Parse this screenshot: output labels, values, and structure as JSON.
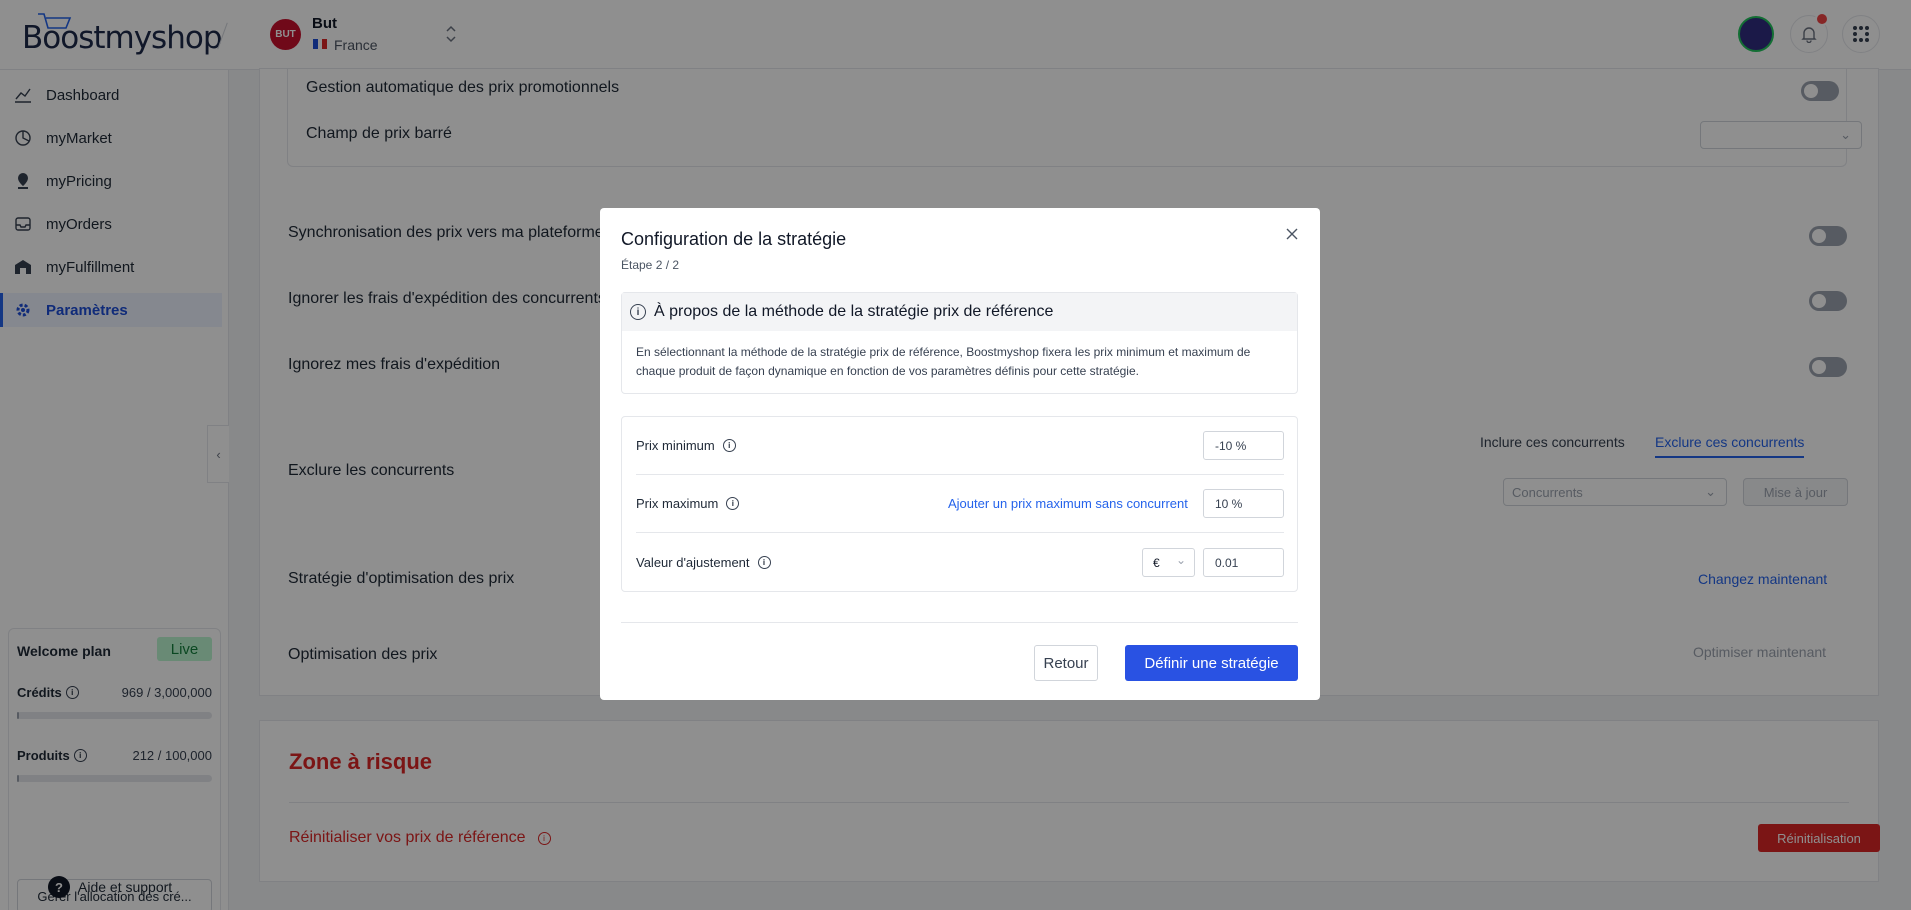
{
  "header": {
    "logo_text": "Boostmyshop",
    "shop_badge": "BUT",
    "shop_name": "But",
    "shop_country": "France"
  },
  "sidebar": {
    "items": [
      {
        "label": "Dashboard",
        "icon": "chart-line-icon"
      },
      {
        "label": "myMarket",
        "icon": "market-icon"
      },
      {
        "label": "myPricing",
        "icon": "pricing-pin-icon"
      },
      {
        "label": "myOrders",
        "icon": "inbox-icon"
      },
      {
        "label": "myFulfillment",
        "icon": "warehouse-icon"
      },
      {
        "label": "Paramètres",
        "icon": "gear-icon",
        "active": true
      }
    ],
    "plan": {
      "name": "Welcome plan",
      "badge": "Live",
      "credits_label": "Crédits",
      "credits_value": "969 / 3,000,000",
      "credits_fraction": 0.0003,
      "products_label": "Produits",
      "products_value": "212 / 100,000",
      "products_fraction": 0.002,
      "allocation_button": "Gérer l'allocation des cré..."
    },
    "help": "Aide et support"
  },
  "main": {
    "promo_auto": "Gestion automatique des prix promotionnels",
    "strike_price": "Champ de prix barré",
    "sync_prices": "Synchronisation des prix vers ma plateforme",
    "ignore_competitor_shipping": "Ignorer les frais d'expédition des concurrents",
    "ignore_my_shipping": "Ignorez mes frais d'expédition",
    "exclude_competitors": "Exclure les concurrents",
    "tab_include": "Inclure ces concurrents",
    "tab_exclude": "Exclure ces concurrents",
    "competitors_placeholder": "Concurrents",
    "update_button": "Mise à jour",
    "optimization_strategy": "Stratégie d'optimisation des prix",
    "change_now": "Changez maintenant",
    "price_optimization": "Optimisation des prix",
    "optimize_now": "Optimiser maintenant",
    "risk_zone": "Zone à risque",
    "reset_reference": "Réinitialiser vos prix de référence",
    "reset_button": "Réinitialisation"
  },
  "modal": {
    "title": "Configuration de la stratégie",
    "step": "Étape 2 / 2",
    "info_title": "À propos de la méthode de la stratégie prix de référence",
    "info_text": "En sélectionnant la méthode de la stratégie prix de référence, Boostmyshop fixera les prix minimum et maximum de chaque produit de façon dynamique en fonction de vos paramètres définis pour cette stratégie.",
    "min_label": "Prix minimum",
    "min_value": "-10 %",
    "max_label": "Prix maximum",
    "max_link": "Ajouter un prix maximum sans concurrent",
    "max_value": "10 %",
    "adjust_label": "Valeur d'ajustement",
    "adjust_currency": "€",
    "adjust_value": "0.01",
    "back_button": "Retour",
    "submit_button": "Définir une stratégie"
  },
  "colors": {
    "primary": "#2952e3",
    "danger": "#dc2626",
    "live": "#15803d"
  }
}
